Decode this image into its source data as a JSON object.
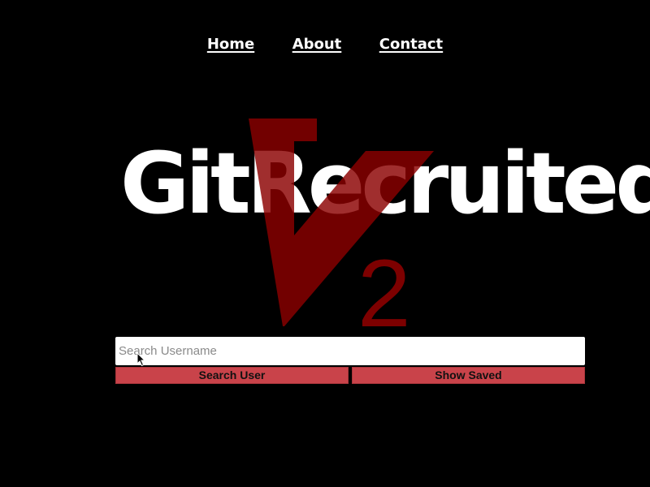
{
  "nav": {
    "items": [
      {
        "label": "Home"
      },
      {
        "label": "About"
      },
      {
        "label": "Contact"
      }
    ]
  },
  "brand": {
    "name": "GitRecruited",
    "version_mark": "2",
    "logo_overlay_color": "#8b0000"
  },
  "search": {
    "placeholder": "Search Username",
    "value": ""
  },
  "buttons": {
    "search_user": "Search User",
    "show_saved": "Show Saved"
  },
  "colors": {
    "background": "#000000",
    "button": "#c9434a",
    "text_light": "#ffffff"
  }
}
